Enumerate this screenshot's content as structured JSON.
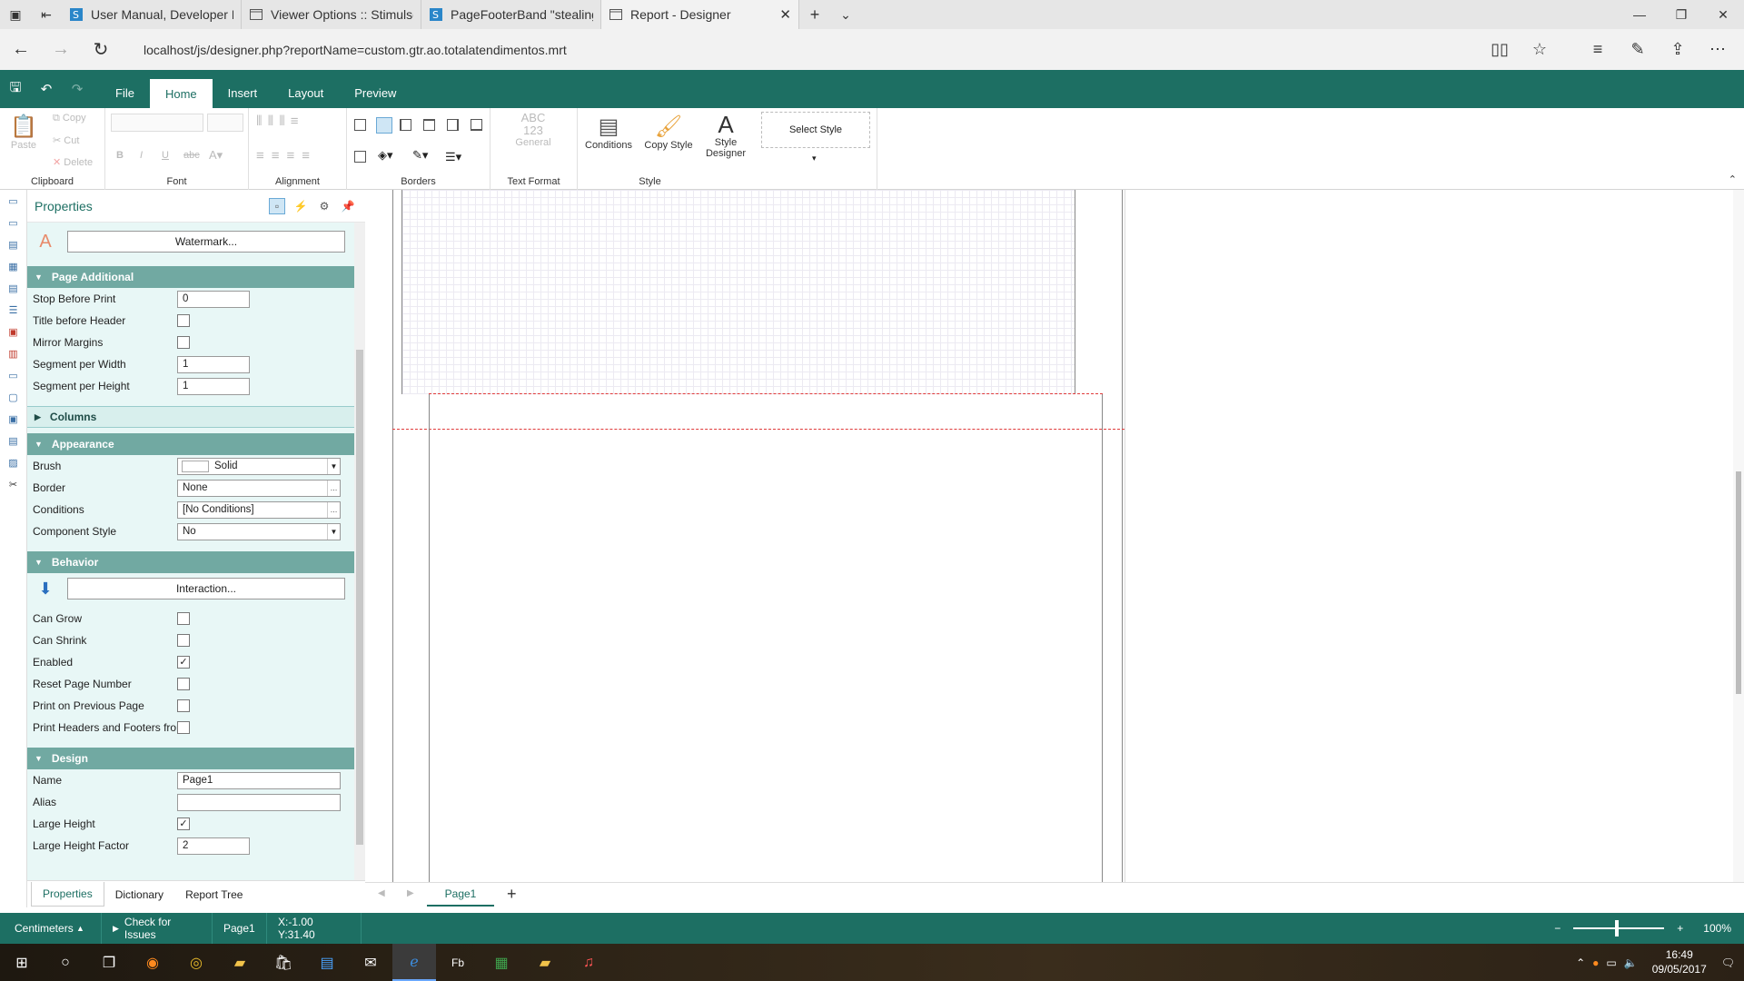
{
  "browser": {
    "tabs": [
      {
        "title": "User Manual, Developer FAQ"
      },
      {
        "title": "Viewer Options :: Stimulsoft"
      },
      {
        "title": "PageFooterBand \"stealing\" s"
      },
      {
        "title": "Report - Designer"
      }
    ],
    "url": "localhost/js/designer.php?reportName=custom.gtr.ao.totalatendimentos.mrt"
  },
  "ribbon": {
    "tabs": [
      "File",
      "Home",
      "Insert",
      "Layout",
      "Preview"
    ],
    "active_tab": "Home",
    "clipboard": {
      "paste": "Paste",
      "copy": "Copy",
      "cut": "Cut",
      "delete": "Delete",
      "label": "Clipboard"
    },
    "font": {
      "bold": "B",
      "italic": "I",
      "underline": "U",
      "strike": "abc",
      "label": "Font"
    },
    "alignment": {
      "label": "Alignment"
    },
    "borders": {
      "label": "Borders"
    },
    "text_format": {
      "abc": "ABC",
      "num": "123",
      "general": "General",
      "label": "Text Format"
    },
    "style": {
      "conditions": "Conditions",
      "copy_style": "Copy Style",
      "style_designer": "Style Designer",
      "select_style": "Select Style",
      "label": "Style"
    }
  },
  "properties": {
    "title": "Properties",
    "watermark_button": "Watermark...",
    "page_additional": {
      "title": "Page Additional",
      "rows": [
        {
          "label": "Stop Before Print",
          "value": "0"
        },
        {
          "label": "Title before Header",
          "checked": false
        },
        {
          "label": "Mirror Margins",
          "checked": false
        },
        {
          "label": "Segment per Width",
          "value": "1"
        },
        {
          "label": "Segment per Height",
          "value": "1"
        }
      ]
    },
    "columns": {
      "title": "Columns"
    },
    "appearance": {
      "title": "Appearance",
      "brush_label": "Brush",
      "brush_value": "Solid",
      "border_label": "Border",
      "border_value": "None",
      "conditions_label": "Conditions",
      "conditions_value": "[No Conditions]",
      "component_style_label": "Component Style",
      "component_style_value": "No"
    },
    "behavior": {
      "title": "Behavior",
      "interaction_button": "Interaction...",
      "rows": [
        {
          "label": "Can Grow",
          "checked": false
        },
        {
          "label": "Can Shrink",
          "checked": false
        },
        {
          "label": "Enabled",
          "checked": true
        },
        {
          "label": "Reset Page Number",
          "checked": false
        },
        {
          "label": "Print on Previous Page",
          "checked": false
        },
        {
          "label": "Print Headers and Footers fror",
          "checked": false
        }
      ]
    },
    "design": {
      "title": "Design",
      "name_label": "Name",
      "name_value": "Page1",
      "alias_label": "Alias",
      "alias_value": "",
      "large_height_label": "Large Height",
      "large_height_checked": true,
      "large_height_factor_label": "Large Height Factor",
      "large_height_factor_value": "2"
    }
  },
  "panel_tabs": [
    "Properties",
    "Dictionary",
    "Report Tree"
  ],
  "page_tabs": {
    "current": "Page1",
    "add": "+"
  },
  "status": {
    "units": "Centimeters",
    "check": "Check for Issues",
    "page": "Page1",
    "coords": "X:-1.00 Y:31.40",
    "zoom_minus": "−",
    "zoom_plus": "+",
    "zoom": "100%"
  },
  "taskbar": {
    "time": "16:49",
    "date": "09/05/2017"
  },
  "colors": {
    "accent": "#1d6f63",
    "section": "#71a9a2",
    "panel_bg": "#e8f7f6"
  }
}
